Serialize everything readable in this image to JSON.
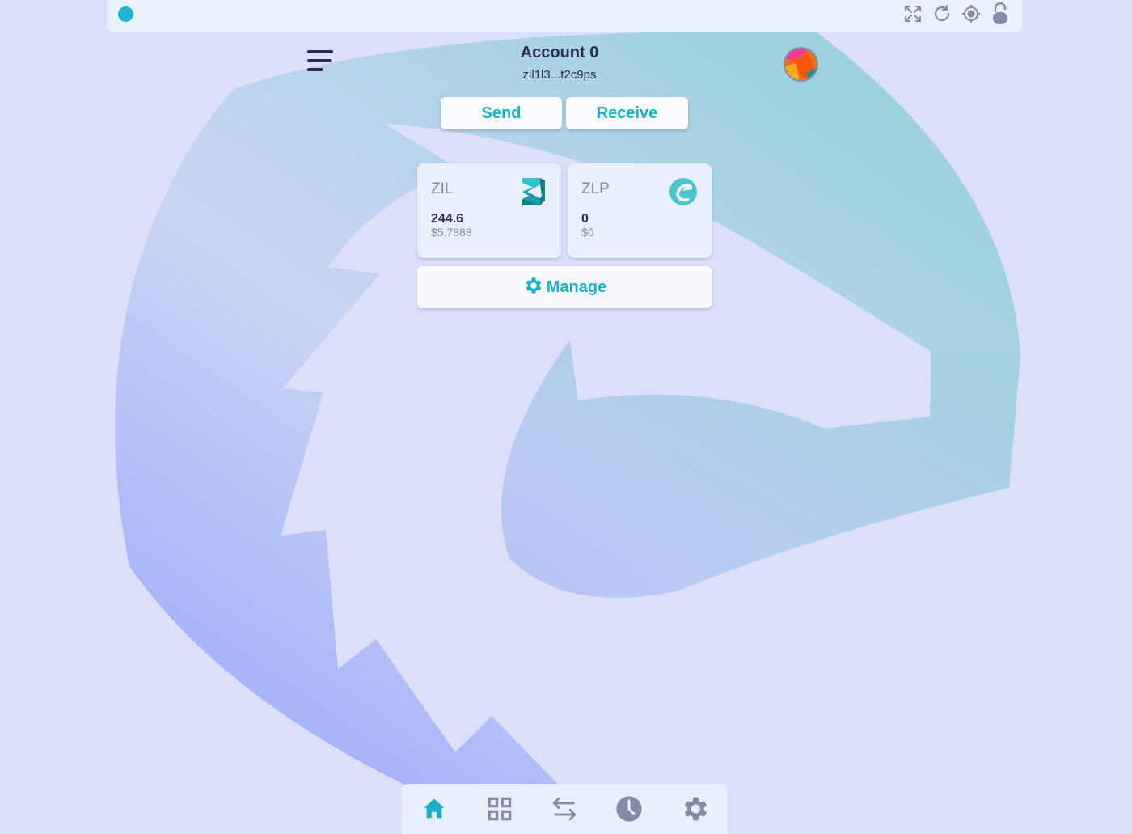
{
  "colors": {
    "accent": "#1bb0c6",
    "text_primary": "#2a2c56",
    "text_muted": "#7f8aa9",
    "icon_muted": "#858aa8",
    "background": "#dcdff8",
    "card": "#e8f0fd"
  },
  "topbar": {
    "status": "connected",
    "icons": [
      "expand-icon",
      "refresh-icon",
      "target-icon",
      "lock-icon"
    ]
  },
  "header": {
    "menu_icon": "hamburger-menu-icon",
    "account_name": "Account 0",
    "account_address": "zil1l3...t2c9ps",
    "avatar": "account-avatar"
  },
  "actions": {
    "send_label": "Send",
    "receive_label": "Receive"
  },
  "tokens": [
    {
      "symbol": "ZIL",
      "amount": "244.6",
      "fiat": "$5.7888",
      "icon": "zilliqa-logo-icon"
    },
    {
      "symbol": "ZLP",
      "amount": "0",
      "fiat": "$0",
      "icon": "zilpay-logo-icon"
    }
  ],
  "manage": {
    "label": "Manage",
    "icon": "gear-icon"
  },
  "bottom_nav": {
    "items": [
      {
        "name": "home",
        "icon": "home-icon",
        "active": true
      },
      {
        "name": "browser",
        "icon": "apps-grid-icon",
        "active": false
      },
      {
        "name": "swap",
        "icon": "transfer-arrows-icon",
        "active": false
      },
      {
        "name": "history",
        "icon": "clock-icon",
        "active": false
      },
      {
        "name": "settings",
        "icon": "settings-gear-icon",
        "active": false
      }
    ]
  }
}
